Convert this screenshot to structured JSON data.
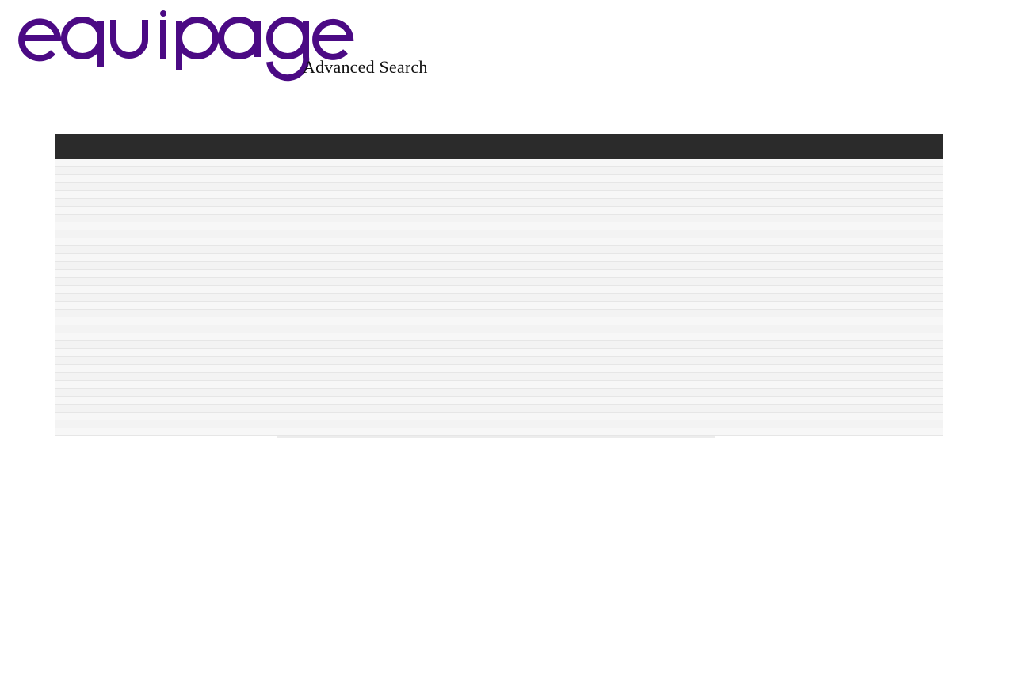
{
  "brand": {
    "logo_text": "equipage",
    "subtitle": "Advanced Search",
    "logo_color": "#4b0a84"
  },
  "results": {
    "header_color": "#2b2b2b",
    "row_count": 35
  }
}
